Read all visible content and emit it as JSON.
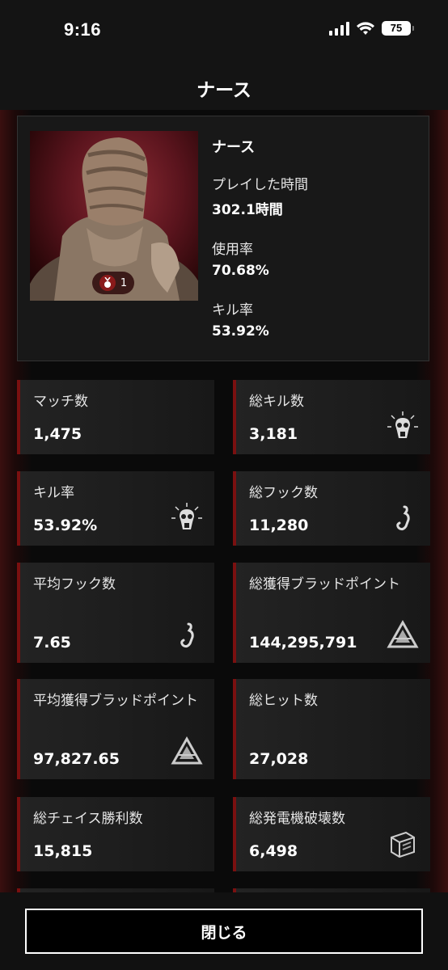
{
  "status_bar": {
    "time": "9:16",
    "battery": "75"
  },
  "header": {
    "title": "ナース"
  },
  "hero": {
    "name": "ナース",
    "prestige": "1",
    "stats": [
      {
        "label": "プレイした時間",
        "value": "302.1時間"
      },
      {
        "label": "使用率",
        "value": "70.68%"
      },
      {
        "label": "キル率",
        "value": "53.92%"
      }
    ]
  },
  "cards": [
    {
      "label": "マッチ数",
      "value": "1,475",
      "icon": ""
    },
    {
      "label": "総キル数",
      "value": "3,181",
      "icon": "skull-icon"
    },
    {
      "label": "キル率",
      "value": "53.92%",
      "icon": "skull-icon"
    },
    {
      "label": "総フック数",
      "value": "11,280",
      "icon": "hook-icon"
    },
    {
      "label": "平均フック数",
      "value": "7.65",
      "icon": "hook-icon"
    },
    {
      "label": "総獲得ブラッドポイント",
      "value": "144,295,791",
      "icon": "bloodpoints-icon"
    },
    {
      "label": "平均獲得ブラッドポイント",
      "value": "97,827.65",
      "icon": "bloodpoints-icon"
    },
    {
      "label": "総ヒット数",
      "value": "27,028",
      "icon": ""
    },
    {
      "label": "総チェイス勝利数",
      "value": "15,815",
      "icon": ""
    },
    {
      "label": "総発電機破壊数",
      "value": "6,498",
      "icon": "generator-icon"
    }
  ],
  "footer": {
    "close_label": "閉じる"
  },
  "colors": {
    "accent": "#7a1010",
    "background": "#0e0e0e"
  }
}
